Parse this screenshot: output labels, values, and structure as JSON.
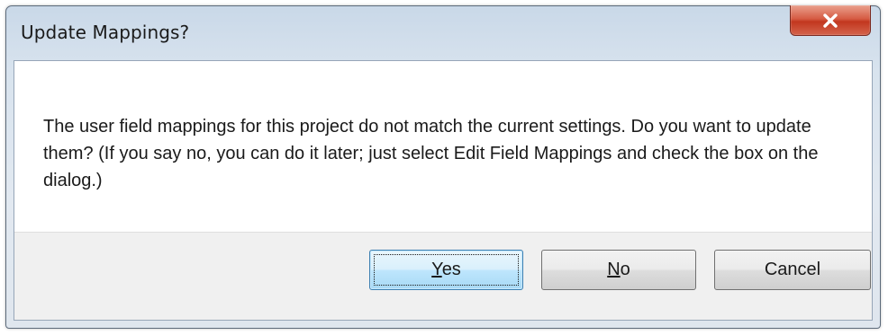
{
  "dialog": {
    "title": "Update Mappings?",
    "message": "The user field mappings for this project do not match the current settings.  Do you want to update them?  (If you say no, you can do it later; just select Edit Field Mappings and check the box on the dialog.)",
    "buttons": {
      "yes": {
        "accel": "Y",
        "rest": "es"
      },
      "no": {
        "accel": "N",
        "rest": "o"
      },
      "cancel": {
        "label": "Cancel"
      }
    },
    "close_icon": "close-x-icon"
  },
  "colors": {
    "close_button": "#c2371f",
    "default_button_border": "#3c7fb1",
    "footer_background": "#f0f0f0"
  }
}
